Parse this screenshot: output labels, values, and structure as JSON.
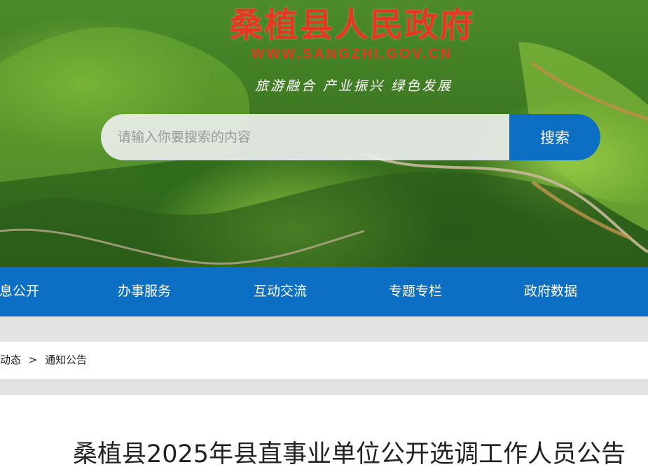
{
  "header": {
    "site_title": "桑植县人民政府",
    "site_url": "WWW.SANGZHI.GOV.CN",
    "slogan": "旅游融合 产业振兴 绿色发展"
  },
  "search": {
    "placeholder": "请输入你要搜索的内容",
    "value": "",
    "button_label": "搜索"
  },
  "nav": {
    "items": [
      {
        "label": "信息公开"
      },
      {
        "label": "办事服务"
      },
      {
        "label": "互动交流"
      },
      {
        "label": "专题专栏"
      },
      {
        "label": "政府数据"
      }
    ]
  },
  "breadcrumb": {
    "parent": "桑植动态",
    "separator": ">",
    "current": "通知公告"
  },
  "article": {
    "title": "桑植县2025年县直事业单位公开选调工作人员公告"
  },
  "colors": {
    "brand_red": "#e23a1f",
    "nav_blue": "#0d6fc4",
    "band_gray": "#e3e3e3"
  }
}
